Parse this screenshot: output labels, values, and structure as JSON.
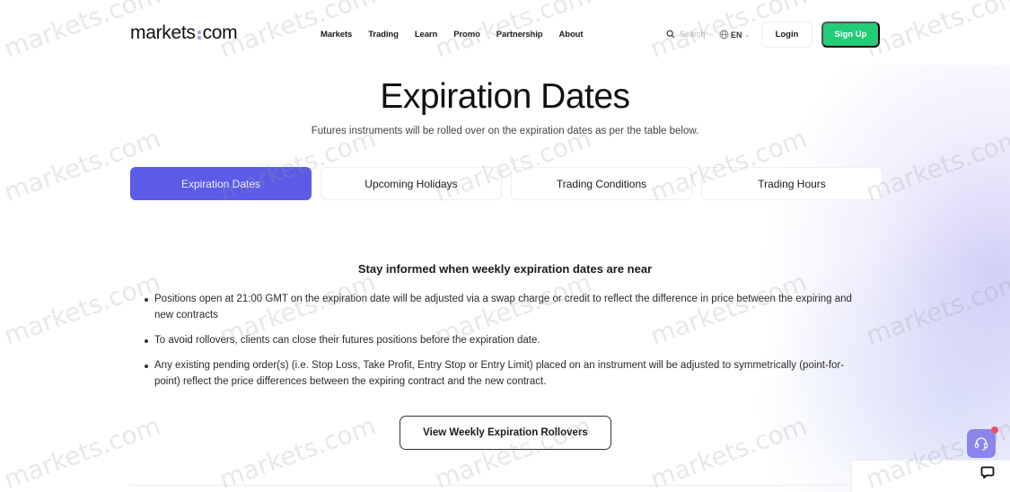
{
  "header": {
    "logo": {
      "left": "markets",
      "right": "com"
    },
    "nav": [
      "Markets",
      "Trading",
      "Learn",
      "Promo",
      "Partnership",
      "About"
    ],
    "search_placeholder": "Search",
    "language": "EN",
    "login_label": "Login",
    "signup_label": "Sign Up"
  },
  "hero": {
    "title": "Expiration Dates",
    "subtitle": "Futures instruments will be rolled over on the expiration dates as per the table below."
  },
  "tabs": [
    {
      "label": "Expiration Dates",
      "active": true
    },
    {
      "label": "Upcoming Holidays",
      "active": false
    },
    {
      "label": "Trading Conditions",
      "active": false
    },
    {
      "label": "Trading Hours",
      "active": false
    }
  ],
  "content": {
    "heading": "Stay informed when weekly expiration dates are near",
    "bullets": [
      "Positions open at 21:00 GMT on the expiration date will be adjusted via a swap charge or credit to reflect the difference in price between the expiring and new contracts",
      "To avoid rollovers, clients can close their futures positions before the expiration date.",
      "Any existing pending order(s) (i.e. Stop Loss, Take Profit, Entry Stop or Entry Limit) placed on an instrument will be adjusted to symmetrically (point-for-point) reflect the price differences between the expiring contract and the new contract."
    ],
    "cta_label": "View Weekly Expiration Rollovers"
  },
  "watermark_text": "markets.com",
  "colors": {
    "accent": "#5b5be8",
    "signup": "#22cd78",
    "support": "#8b85ee",
    "badge": "#f24b6a"
  }
}
